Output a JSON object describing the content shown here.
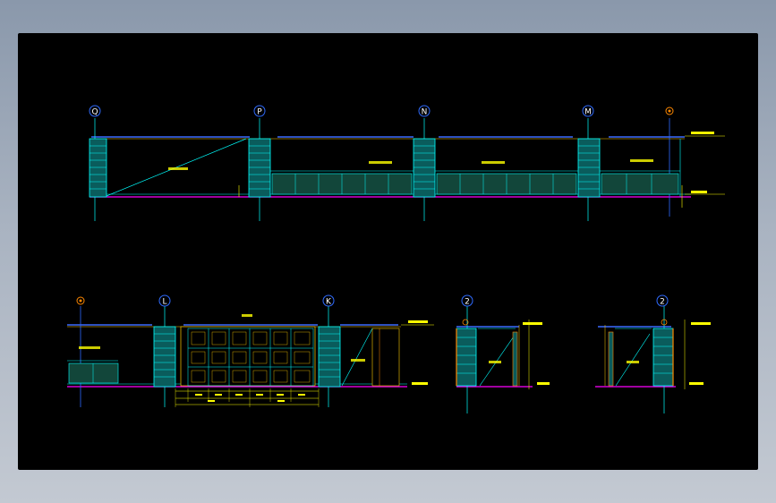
{
  "grid_labels": {
    "top": [
      "Q",
      "P",
      "N",
      "M"
    ],
    "bottom_left": [
      "L",
      "K"
    ],
    "bottom_right": [
      "2",
      "2"
    ]
  },
  "colors": {
    "background": "#000000",
    "frame": "#00ffff",
    "floor_line": "#ff00ff",
    "column_fill": "#0a6b6b",
    "column_line": "#00ffff",
    "panel_fill": "#154f3e",
    "annotation": "#ffff00",
    "bubble": "#2f6bff",
    "orange": "#ff8800",
    "top_beam_blue": "#3a6bff",
    "green": "#00ff66"
  }
}
